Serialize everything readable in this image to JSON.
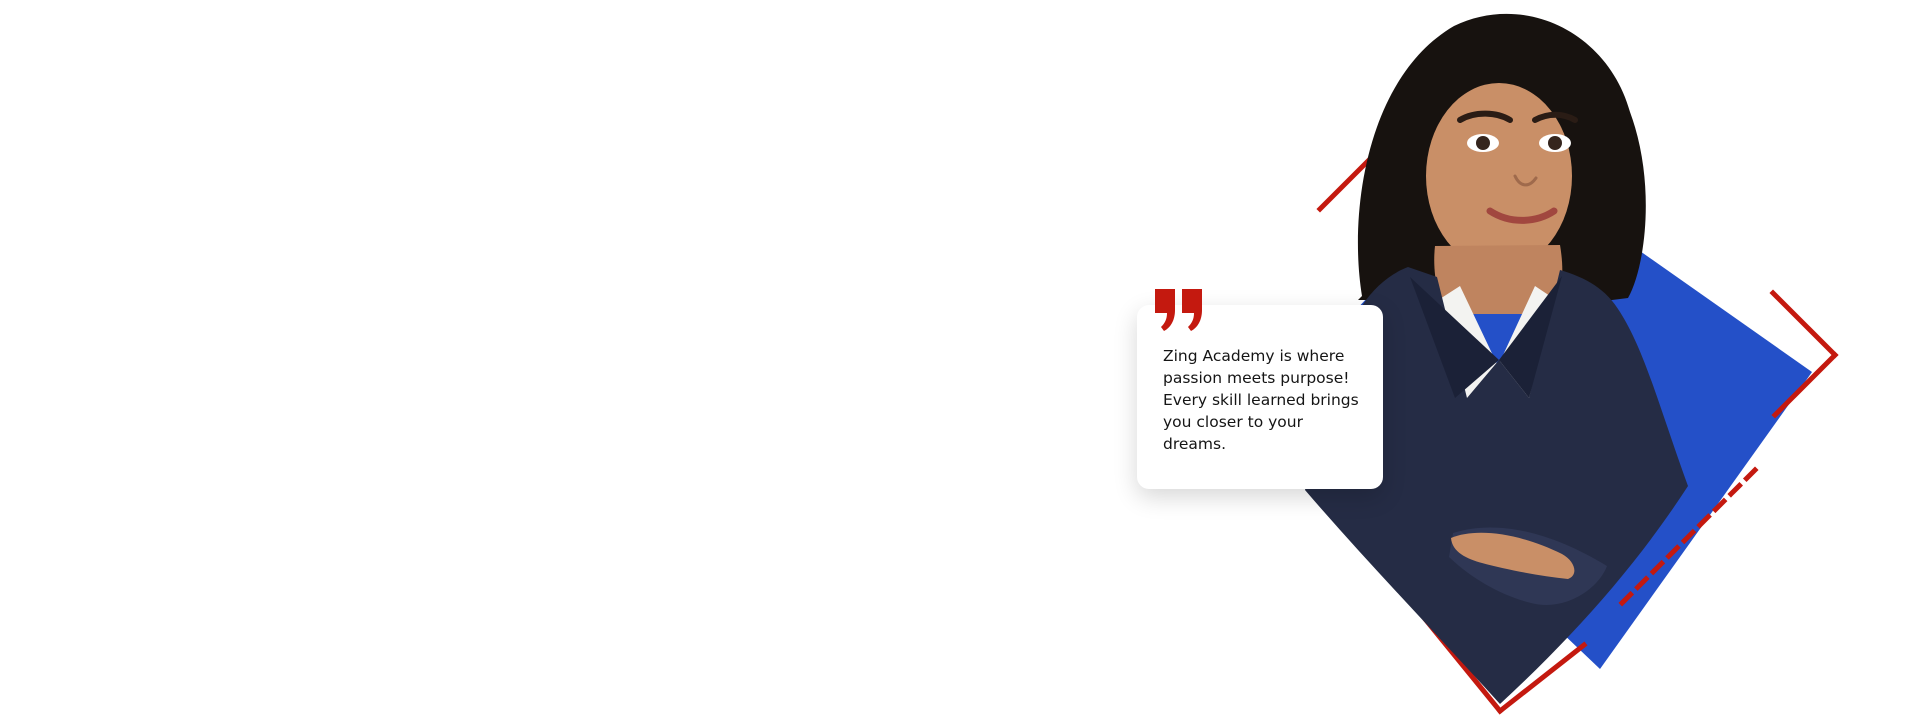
{
  "testimonial": {
    "quote": "Zing Academy is where\npassion meets purpose!\nEvery skill learned brings\nyou closer to your\ndreams."
  },
  "decor": {
    "blue_diamond_color": "#2450c8",
    "red_accent_color": "#c4190f",
    "quote_mark_icon": "double-quote-icon",
    "portrait": "woman-in-navy-blazer"
  }
}
